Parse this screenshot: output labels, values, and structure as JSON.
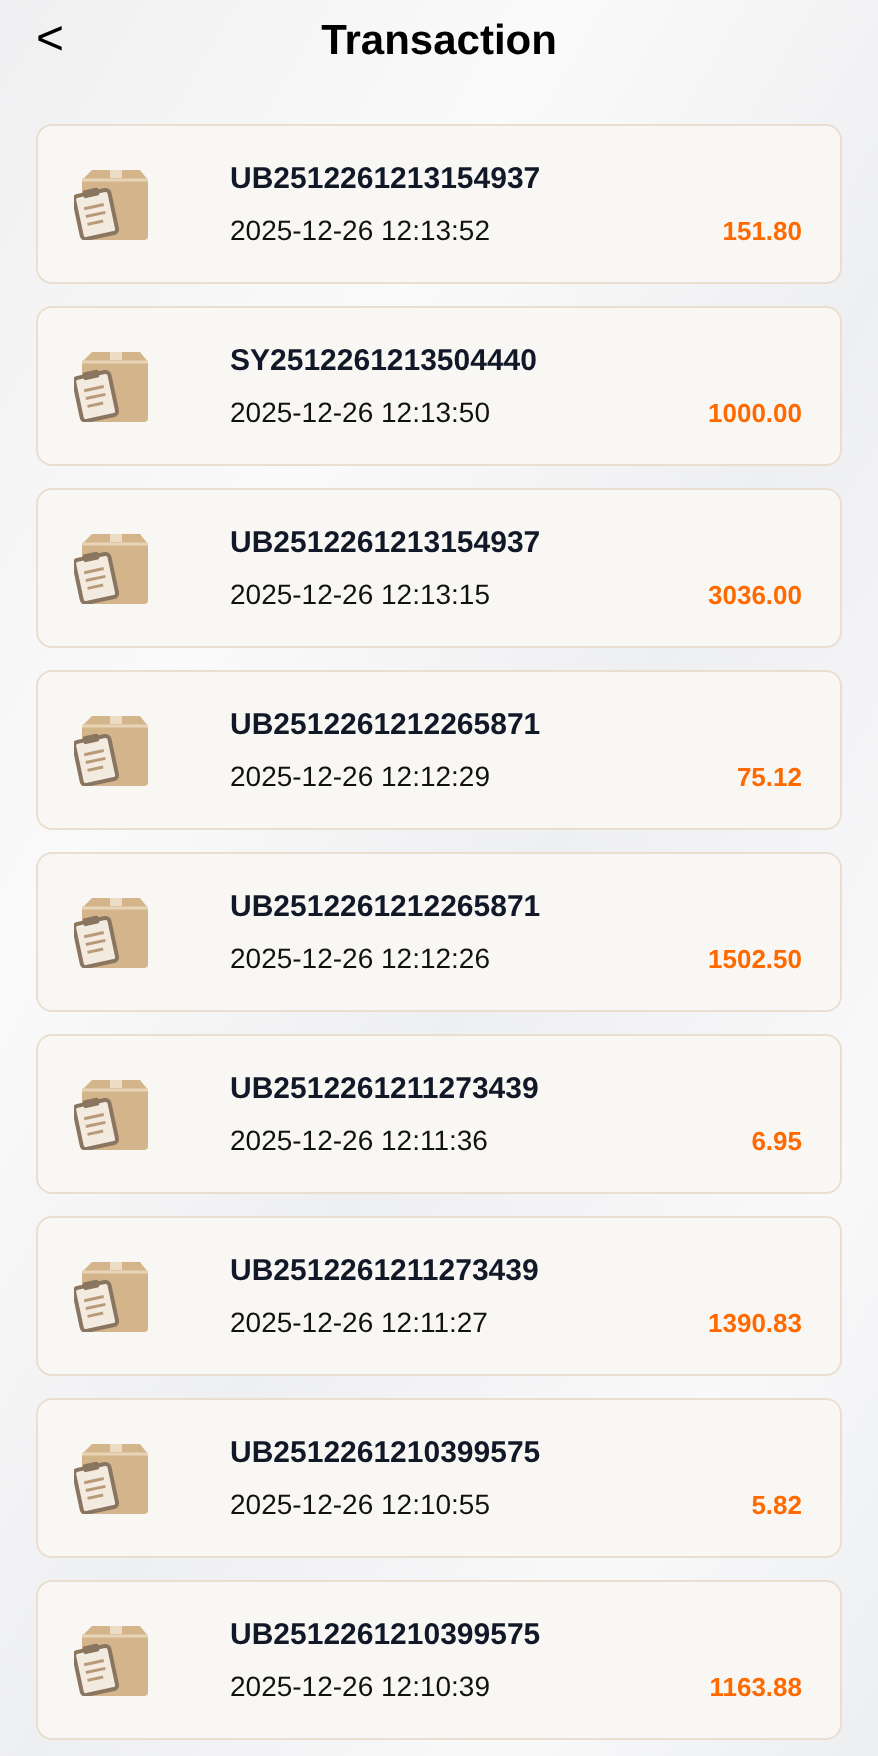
{
  "header": {
    "back": "<",
    "title": "Transaction"
  },
  "transactions": [
    {
      "order_no": "UB2512261213154937",
      "time": "2025-12-26 12:13:52",
      "amount": "151.80"
    },
    {
      "order_no": "SY2512261213504440",
      "time": "2025-12-26 12:13:50",
      "amount": "1000.00"
    },
    {
      "order_no": "UB2512261213154937",
      "time": "2025-12-26 12:13:15",
      "amount": "3036.00"
    },
    {
      "order_no": "UB2512261212265871",
      "time": "2025-12-26 12:12:29",
      "amount": "75.12"
    },
    {
      "order_no": "UB2512261212265871",
      "time": "2025-12-26 12:12:26",
      "amount": "1502.50"
    },
    {
      "order_no": "UB2512261211273439",
      "time": "2025-12-26 12:11:36",
      "amount": "6.95"
    },
    {
      "order_no": "UB2512261211273439",
      "time": "2025-12-26 12:11:27",
      "amount": "1390.83"
    },
    {
      "order_no": "UB2512261210399575",
      "time": "2025-12-26 12:10:55",
      "amount": "5.82"
    },
    {
      "order_no": "UB2512261210399575",
      "time": "2025-12-26 12:10:39",
      "amount": "1163.88"
    }
  ]
}
